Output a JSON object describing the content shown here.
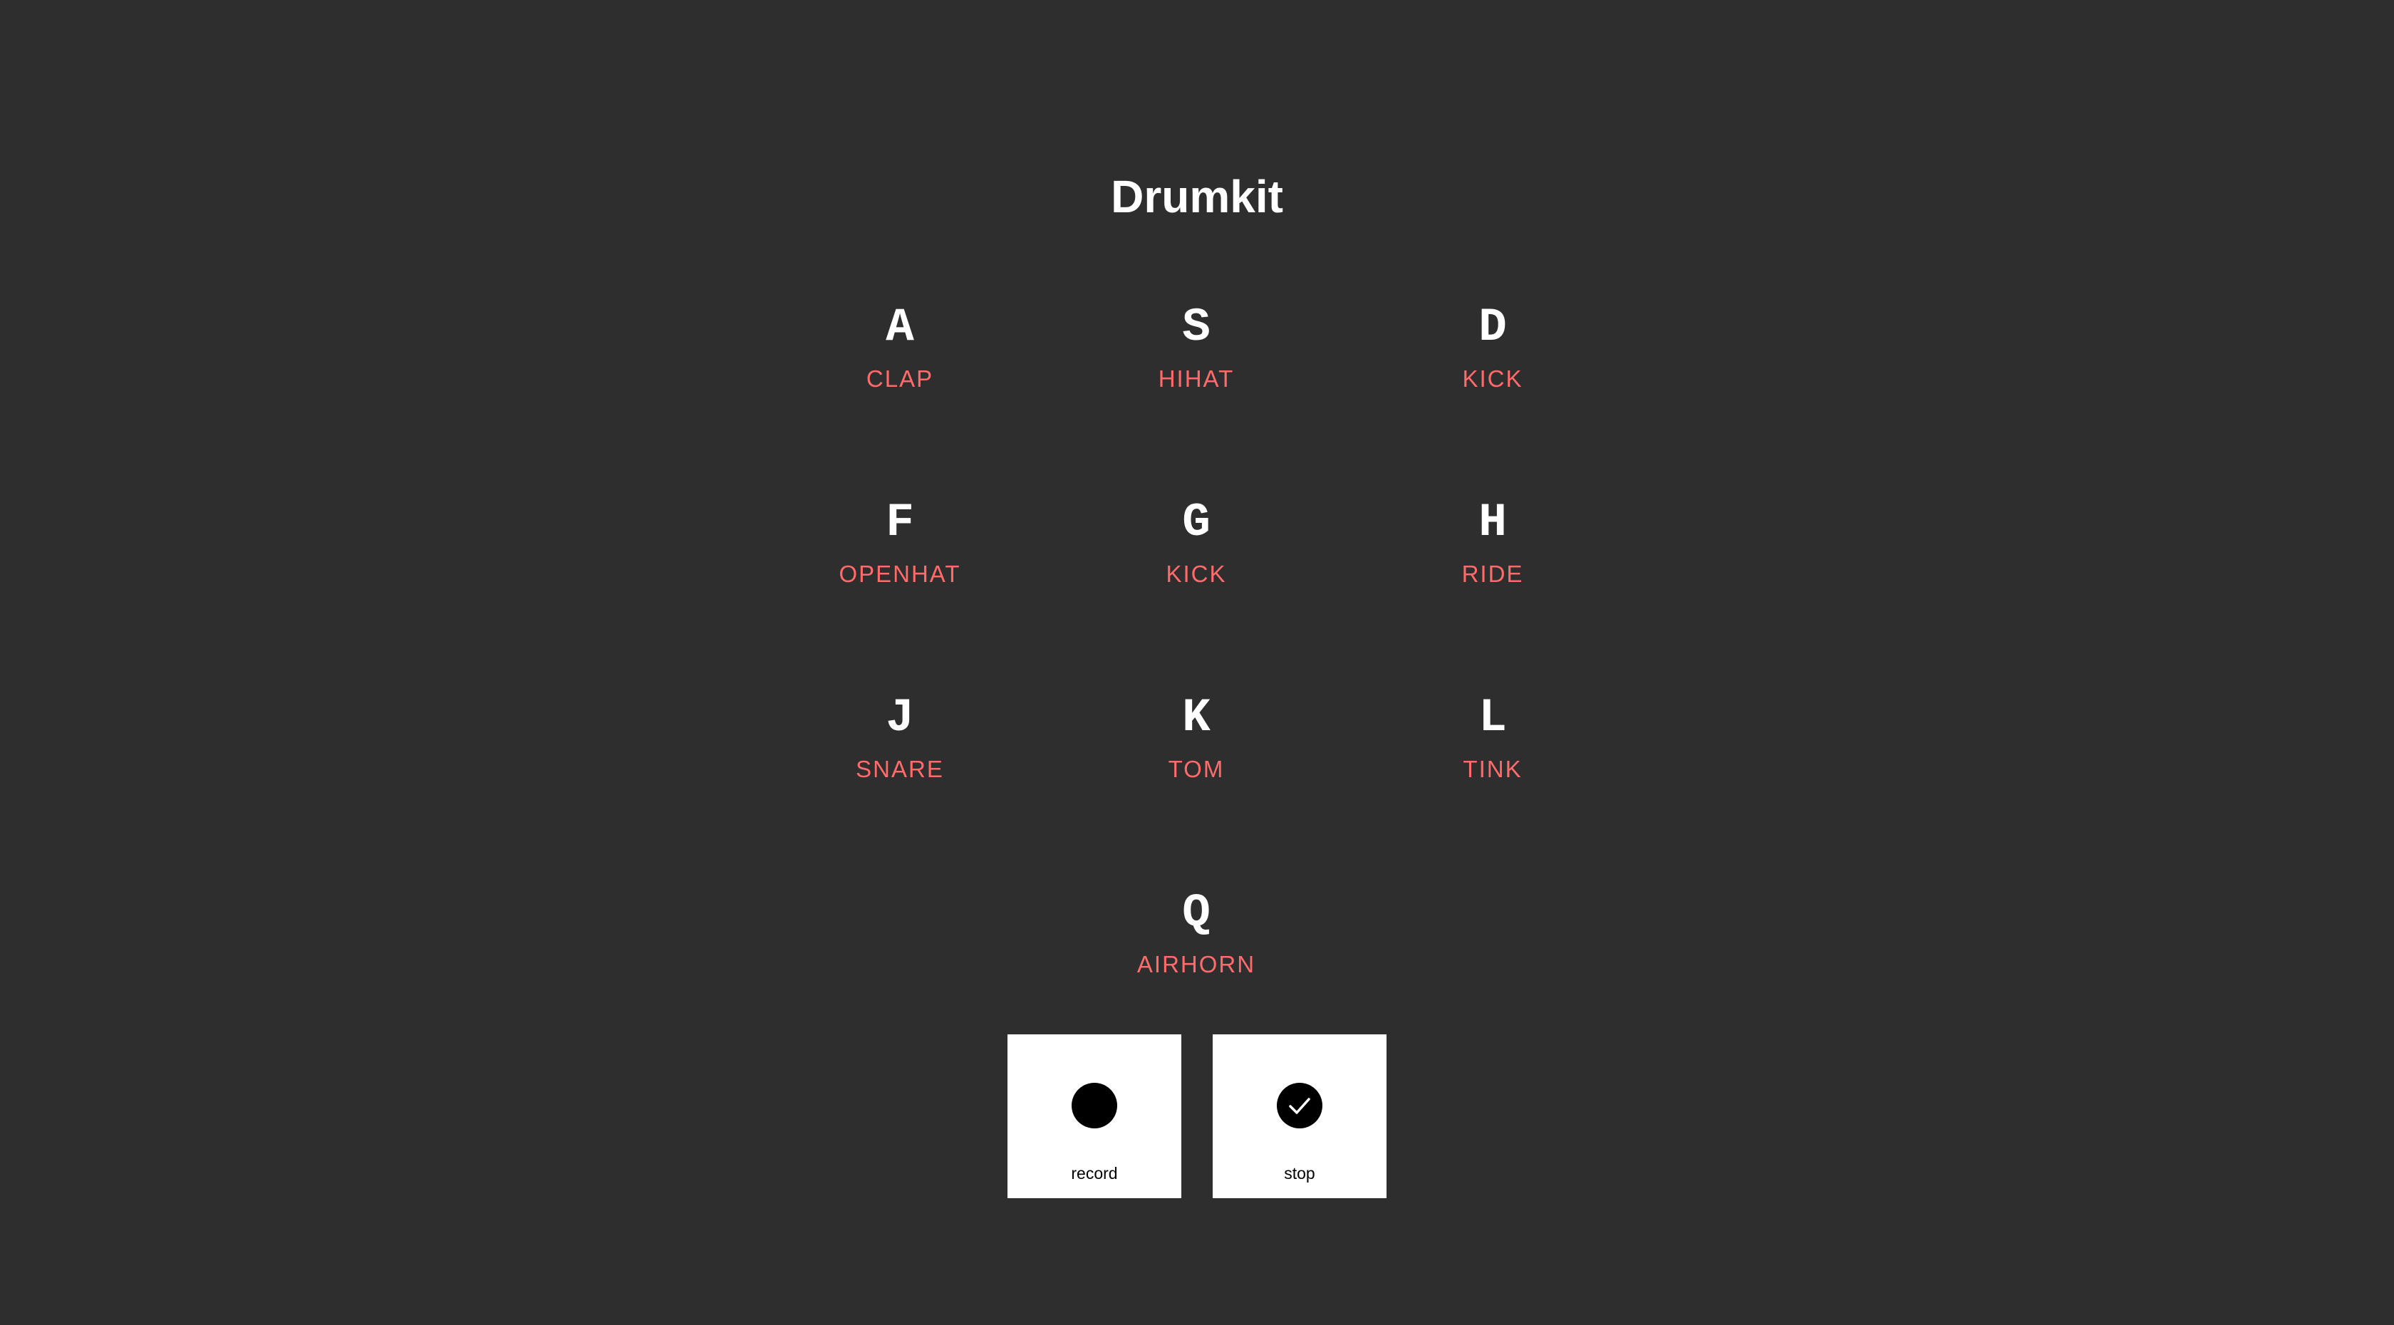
{
  "title": "Drumkit",
  "pads": [
    {
      "key": "A",
      "sound": "CLAP"
    },
    {
      "key": "S",
      "sound": "HIHAT"
    },
    {
      "key": "D",
      "sound": "KICK"
    },
    {
      "key": "F",
      "sound": "OPENHAT"
    },
    {
      "key": "G",
      "sound": "KICK"
    },
    {
      "key": "H",
      "sound": "RIDE"
    },
    {
      "key": "J",
      "sound": "SNARE"
    },
    {
      "key": "K",
      "sound": "TOM"
    },
    {
      "key": "L",
      "sound": "TINK"
    },
    {
      "key": "Q",
      "sound": "AIRHORN"
    }
  ],
  "controls": {
    "record": {
      "label": "record",
      "icon": "record-dot-icon"
    },
    "stop": {
      "label": "stop",
      "icon": "checkmark-circle-icon"
    }
  },
  "colors": {
    "background": "#2e2e2e",
    "sound_label": "#ff6b6b",
    "key_label": "#ffffff",
    "button_background": "#ffffff"
  }
}
